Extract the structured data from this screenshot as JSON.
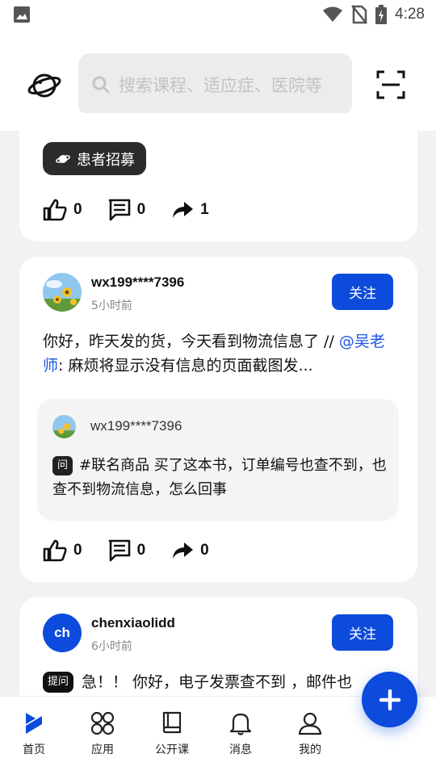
{
  "search": {
    "placeholder": "搜索课程、适应症、医院等"
  },
  "status_bar": {
    "time": "4:28"
  },
  "post1": {
    "tag": "患者招募",
    "likes": "0",
    "comments": "0",
    "shares": "1"
  },
  "post2": {
    "username": "wx199****7396",
    "time": "5小时前",
    "follow_label": "关注",
    "text_before": "你好，昨天发的货，今天看到物流信息了 // ",
    "mention": "@吴老师",
    "text_after": ": 麻烦将显示没有信息的页面截图发...",
    "quote": {
      "username": "wx199****7396",
      "badge": "问",
      "text": "#联名商品 买了这本书，订单编号也查不到，也查不到物流信息，怎么回事"
    },
    "likes": "0",
    "comments": "0",
    "shares": "0"
  },
  "post3": {
    "avatar_initials": "ch",
    "username": "chenxiaolidd",
    "time": "6小时前",
    "follow_label": "关注",
    "badge": "提问",
    "text": "急！！ 你好，电子发票查不到 ，邮件也"
  },
  "nav": {
    "home": "首页",
    "apps": "应用",
    "courses": "公开课",
    "messages": "消息",
    "profile": "我的"
  }
}
